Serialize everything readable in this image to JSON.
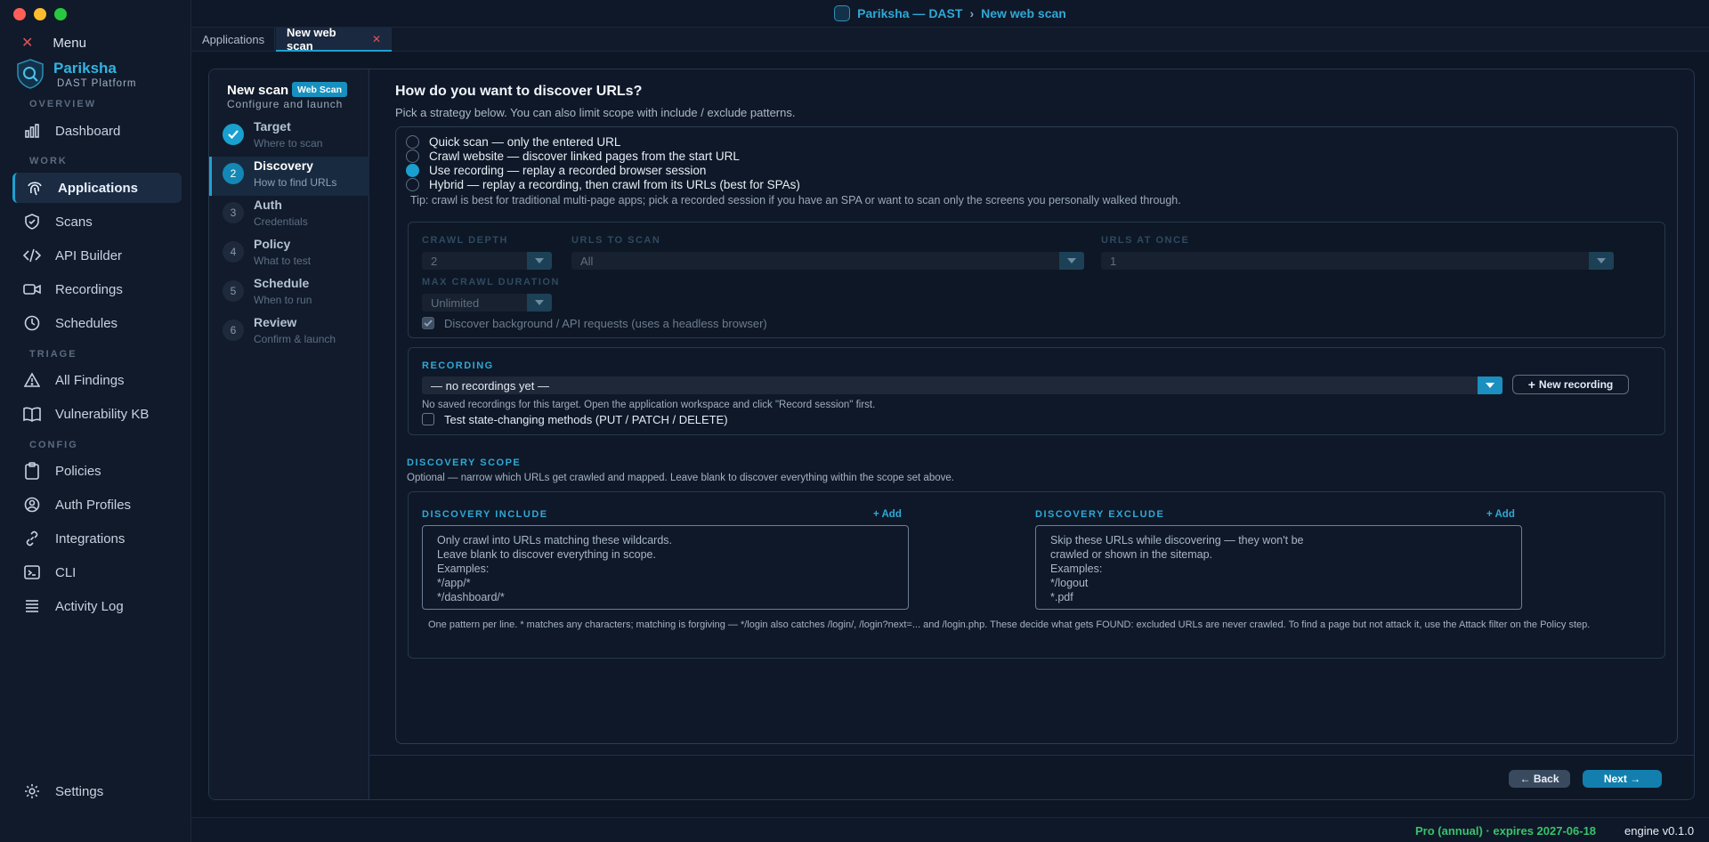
{
  "window": {
    "title": "Pariksha — DAST",
    "title_sep": "›",
    "title_page": "New web scan"
  },
  "sidebar": {
    "menu_label": "Menu",
    "brand": {
      "name": "Pariksha",
      "tagline": "DAST Platform"
    },
    "sections": {
      "overview": "OVERVIEW",
      "work": "WORK",
      "triage": "TRIAGE",
      "config": "CONFIG"
    },
    "items": [
      {
        "label": "Dashboard",
        "icon": "bar-chart-icon"
      },
      {
        "label": "Applications",
        "icon": "fingerprint-icon",
        "active": true
      },
      {
        "label": "Scans",
        "icon": "shield-icon"
      },
      {
        "label": "API Builder",
        "icon": "code-icon"
      },
      {
        "label": "Recordings",
        "icon": "video-camera-icon"
      },
      {
        "label": "Schedules",
        "icon": "clock-icon"
      },
      {
        "label": "All Findings",
        "icon": "warning-triangle-icon"
      },
      {
        "label": "Vulnerability KB",
        "icon": "book-icon"
      },
      {
        "label": "Policies",
        "icon": "clipboard-icon"
      },
      {
        "label": "Auth Profiles",
        "icon": "user-circle-icon"
      },
      {
        "label": "Integrations",
        "icon": "link-icon"
      },
      {
        "label": "CLI",
        "icon": "terminal-icon"
      },
      {
        "label": "Activity Log",
        "icon": "list-icon"
      }
    ],
    "settings": "Settings"
  },
  "tabs": [
    {
      "label": "Applications"
    },
    {
      "label": "New web scan",
      "active": true
    }
  ],
  "wizard": {
    "title": "New scan",
    "badge": "Web Scan",
    "subtitle": "Configure and launch",
    "steps": [
      {
        "num": "1",
        "title": "Target",
        "sub": "Where to scan",
        "state": "done"
      },
      {
        "num": "2",
        "title": "Discovery",
        "sub": "How to find URLs",
        "state": "current"
      },
      {
        "num": "3",
        "title": "Auth",
        "sub": "Credentials",
        "state": "pending"
      },
      {
        "num": "4",
        "title": "Policy",
        "sub": "What to test",
        "state": "pending"
      },
      {
        "num": "5",
        "title": "Schedule",
        "sub": "When to run",
        "state": "pending"
      },
      {
        "num": "6",
        "title": "Review",
        "sub": "Confirm & launch",
        "state": "pending"
      }
    ]
  },
  "discovery": {
    "heading": "How do you want to discover URLs?",
    "subheading": "Pick a strategy below. You can also limit scope with include / exclude patterns.",
    "options": [
      {
        "label": "Quick scan — only the entered URL",
        "selected": false
      },
      {
        "label": "Crawl website — discover linked pages from the start URL",
        "selected": false
      },
      {
        "label": "Use recording — replay a recorded browser session",
        "selected": true
      },
      {
        "label": "Hybrid — replay a recording, then crawl from its URLs (best for SPAs)",
        "selected": false
      }
    ],
    "tip": "Tip: crawl is best for traditional multi-page apps; pick a recorded session if you have an SPA or want to scan only the screens you personally walked through.",
    "crawl": {
      "depth_label": "CRAWL DEPTH",
      "depth_value": "2",
      "urls_label": "URLS TO SCAN",
      "urls_value": "All",
      "concurrency_label": "URLS AT ONCE",
      "concurrency_value": "1",
      "duration_label": "MAX CRAWL DURATION",
      "duration_value": "Unlimited",
      "background_label": "Discover background / API requests (uses a headless browser)",
      "background_checked": true
    },
    "recording": {
      "label": "RECORDING",
      "value": "— no recordings yet —",
      "new_button": "New recording",
      "hint": "No saved recordings for this target. Open the application workspace and click \"Record session\" first.",
      "state_changing_label": "Test state-changing methods (PUT / PATCH / DELETE)",
      "state_changing_checked": false
    },
    "scope": {
      "heading": "DISCOVERY SCOPE",
      "description": "Optional — narrow which URLs get crawled and mapped. Leave blank to discover everything within the scope set above.",
      "include_label": "DISCOVERY INCLUDE",
      "include_add": "+ Add",
      "include_placeholder": "Only crawl into URLs matching these wildcards.\nLeave blank to discover everything in scope.\nExamples:\n*/app/*\n*/dashboard/*",
      "exclude_label": "DISCOVERY EXCLUDE",
      "exclude_add": "+ Add",
      "exclude_placeholder": "Skip these URLs while discovering — they won't be\ncrawled or shown in the sitemap.\nExamples:\n*/logout\n*.pdf",
      "footnote": "One pattern per line. * matches any characters; matching is forgiving — */login also catches /login/, /login?next=... and /login.php. These decide what gets FOUND: excluded URLs are never crawled. To find a page but not attack it, use the Attack filter on the Policy step."
    }
  },
  "footer": {
    "back": "← Back",
    "next": "Next →"
  },
  "status": {
    "license": "Pro (annual) · expires 2027-06-18",
    "engine": "engine v0.1.0"
  },
  "colors": {
    "accent": "#19a0cf",
    "license_green": "#39c36a",
    "close_red": "#ff5f57",
    "minimize_yellow": "#febc2e",
    "zoom_green": "#28c840"
  }
}
